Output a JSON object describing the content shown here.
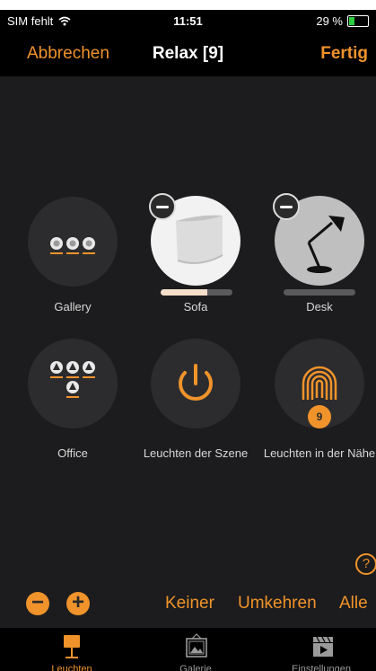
{
  "status_bar": {
    "carrier": "SIM fehlt",
    "time": "11:51",
    "battery": "29 %",
    "battery_level": 0.29
  },
  "nav": {
    "cancel": "Abbrechen",
    "title": "Relax [9]",
    "done": "Fertig"
  },
  "lights": [
    {
      "label": "Gallery"
    },
    {
      "label": "Sofa",
      "brightness": 0.65
    },
    {
      "label": "Desk",
      "brightness": 0.0
    },
    {
      "label": "Office"
    },
    {
      "label": "Leuchten der Szene"
    },
    {
      "label": "Leuchten in der Nähe",
      "badge": "9"
    }
  ],
  "help_icon": "?",
  "controls": {
    "minus": "−",
    "plus": "+",
    "none": "Keiner",
    "invert": "Umkehren",
    "all": "Alle"
  },
  "tabs": [
    {
      "label": "Leuchten",
      "icon": "lamp-icon",
      "active": true
    },
    {
      "label": "Galerie",
      "icon": "gallery-icon",
      "active": false
    },
    {
      "label": "Einstellungen",
      "icon": "settings-icon",
      "active": false
    }
  ],
  "colors": {
    "accent": "#f0932b",
    "background": "#1c1c1e",
    "tile": "#2c2c2e"
  }
}
